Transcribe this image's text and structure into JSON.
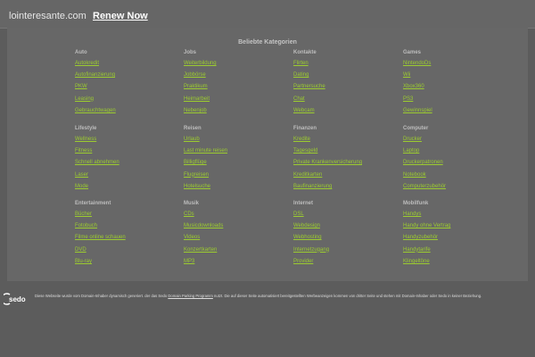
{
  "header": {
    "domain": "lointeresante.com",
    "renew_label": "Renew Now"
  },
  "main": {
    "heading": "Beliebte Kategorien",
    "categories": [
      {
        "title": "Auto",
        "links": [
          "Autokredit",
          "Autofinanzierung",
          "PKW",
          "Leasing",
          "Gebrauchtwagen"
        ]
      },
      {
        "title": "Jobs",
        "links": [
          "Weiterbildung",
          "Jobbörse",
          "Praktikum",
          "Heimarbeit",
          "Nebenjob"
        ]
      },
      {
        "title": "Kontakte",
        "links": [
          "Flirten",
          "Dating",
          "Partnersuche",
          "Chat",
          "Webcam"
        ]
      },
      {
        "title": "Games",
        "links": [
          "NintendoDs",
          "Wii",
          "Xbox360",
          "PS3",
          "Gewinnspiel"
        ]
      },
      {
        "title": "Lifestyle",
        "links": [
          "Wellness",
          "Fitness",
          "Schnell abnehmen",
          "Laser",
          "Mode"
        ]
      },
      {
        "title": "Reisen",
        "links": [
          "Urlaub",
          "Last minute reisen",
          "Billigflüge",
          "Flugreisen",
          "Hotelsuche"
        ]
      },
      {
        "title": "Finanzen",
        "links": [
          "Kredite",
          "Tagesgeld",
          "Private Krankenversicherung",
          "Kreditkarten",
          "Baufinanzierung"
        ]
      },
      {
        "title": "Computer",
        "links": [
          "Drucker",
          "Laptop",
          "Druckerpatronen",
          "Notebook",
          "Computerzubehör"
        ]
      },
      {
        "title": "Entertainment",
        "links": [
          "Bücher",
          "Fotobuch",
          "Filme online schauen",
          "DVD",
          "Blu-ray"
        ]
      },
      {
        "title": "Musik",
        "links": [
          "CDs",
          "Musicdownloads",
          "Videos",
          "Konzertkarten",
          "MP3"
        ]
      },
      {
        "title": "Internet",
        "links": [
          "DSL",
          "Webdesign",
          "Webhosting",
          "Internetzugang",
          "Provider"
        ]
      },
      {
        "title": "Mobilfunk",
        "links": [
          "Handys",
          "Handy ohne Vertrag",
          "Handyzubehör",
          "Handytarife",
          "Klingeltöne"
        ]
      }
    ]
  },
  "footer": {
    "logo_text": "sedo",
    "text_before": "Diese Webseite wurde vom Domain-Inhaber dynamisch generiert. der das Sedo",
    "link_text": "Domain Parking Programm",
    "text_after": "nutzt. Die auf dieser Seite automatisiert bereitgestellten Werbeanzeigen kommen von dritter Seite und stehen mit Domain-Inhaber oder Sedo in keiner Beziehung."
  },
  "colors": {
    "background": "#5c5c5c",
    "panel": "#676767",
    "link": "#9ccc2f",
    "category_title": "#bdbdbd"
  }
}
